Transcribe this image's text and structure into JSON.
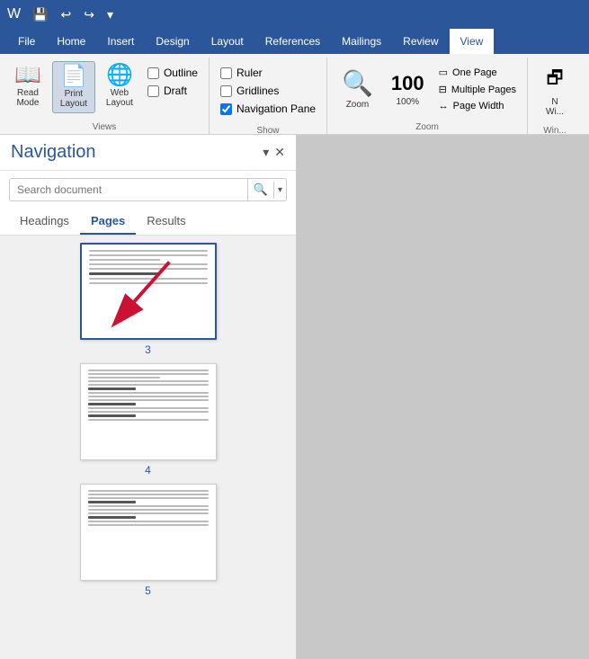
{
  "titlebar": {
    "save_icon": "💾",
    "undo_icon": "↩",
    "redo_icon": "↪",
    "dropdown_icon": "▾"
  },
  "tabs": [
    {
      "label": "File",
      "active": false
    },
    {
      "label": "Home",
      "active": false
    },
    {
      "label": "Insert",
      "active": false
    },
    {
      "label": "Design",
      "active": false
    },
    {
      "label": "Layout",
      "active": false
    },
    {
      "label": "References",
      "active": false
    },
    {
      "label": "Mailings",
      "active": false
    },
    {
      "label": "Review",
      "active": false
    },
    {
      "label": "View",
      "active": true
    }
  ],
  "ribbon": {
    "views_group": {
      "label": "Views",
      "read_mode_label": "Read\nMode",
      "print_layout_label": "Print\nLayout",
      "web_layout_label": "Web\nLayout",
      "outline_label": "Outline",
      "draft_label": "Draft"
    },
    "show_group": {
      "label": "Show",
      "ruler_label": "Ruler",
      "ruler_checked": false,
      "gridlines_label": "Gridlines",
      "gridlines_checked": false,
      "nav_pane_label": "Navigation Pane",
      "nav_pane_checked": true
    },
    "zoom_group": {
      "label": "Zoom",
      "zoom_label": "Zoom",
      "zoom_pct_label": "100%",
      "one_page_label": "One Page",
      "multiple_pages_label": "Multiple Pages",
      "page_width_label": "Page Width"
    },
    "window_group": {
      "label": "Win..."
    }
  },
  "navigation": {
    "title": "Navigation",
    "search_placeholder": "Search document",
    "tabs": [
      "Headings",
      "Pages",
      "Results"
    ],
    "active_tab": "Pages",
    "pages": [
      {
        "num": "3",
        "selected": true
      },
      {
        "num": "4",
        "selected": false
      },
      {
        "num": "5",
        "selected": false
      }
    ],
    "close_icon": "✕",
    "dropdown_icon": "▾"
  }
}
